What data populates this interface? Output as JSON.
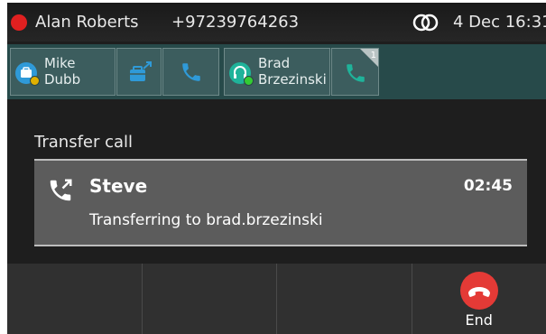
{
  "status_bar": {
    "contact_name": "Alan Roberts",
    "phone_number": "+97239764263",
    "datetime": "4 Dec 16:31",
    "indicator_color": "#e02020"
  },
  "blf": {
    "tiles": [
      {
        "line1": "Mike",
        "line2": "Dubb",
        "icon": "contact-card-icon",
        "presence_color": "#e0b000"
      },
      {
        "icon": "transfer-briefcase-icon"
      },
      {
        "icon": "phone-icon"
      },
      {
        "line1": "Brad",
        "line2": "Brzezinski",
        "icon": "headset-icon",
        "presence_color": "#33cc33"
      },
      {
        "icon": "phone-icon",
        "count": "1"
      }
    ]
  },
  "main": {
    "section_title": "Transfer call",
    "call": {
      "caller": "Steve",
      "duration": "02:45",
      "status": "Transferring to brad.brzezinski",
      "icon": "outgoing-call-icon"
    }
  },
  "softkeys": {
    "end_label": "End",
    "end_color": "#e43a36"
  }
}
